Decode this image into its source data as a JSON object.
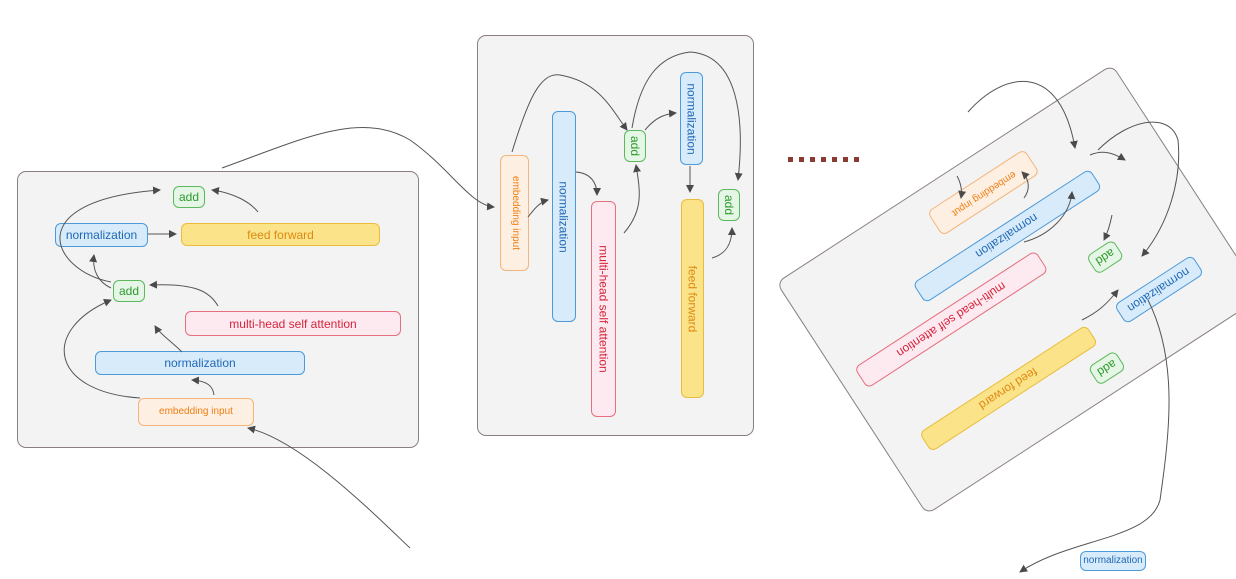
{
  "diagram": {
    "panel_left": {
      "add_top": "add",
      "normalization_top": "normalization",
      "feed_forward": "feed forward",
      "add_bottom": "add",
      "mhsa": "multi-head self attention",
      "normalization_bottom": "normalization",
      "embedding_input": "embedding input"
    },
    "panel_middle": {
      "embedding_input": "embedding input",
      "normalization_1": "normalization",
      "mhsa": "multi-head self attention",
      "add_1": "add",
      "normalization_2": "normalization",
      "feed_forward": "feed forward",
      "add_2": "add"
    },
    "panel_right": {
      "embedding_input": "embedding input",
      "normalization_1": "normalization",
      "mhsa": "multi-head self attention",
      "add_1": "add",
      "normalization_2": "normalization",
      "feed_forward": "feed forward",
      "add_2": "add"
    },
    "final_normalization": "normalization"
  },
  "colors": {
    "normalization": "#4c9ad9",
    "add": "#5bb95b",
    "feed_forward": "#e9bd3b",
    "attention": "#e5707f",
    "embedding": "#f2b57a",
    "ellipsis": "#8b3a32"
  }
}
